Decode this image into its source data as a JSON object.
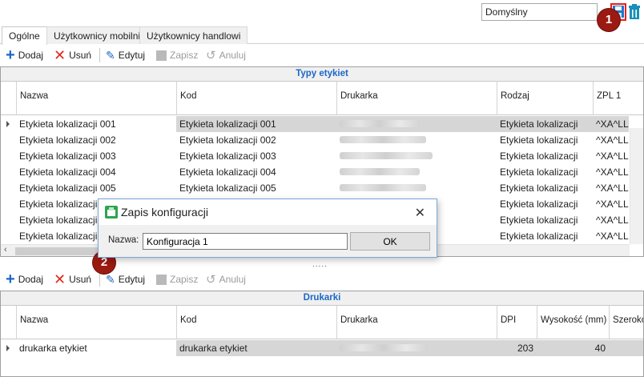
{
  "topbar": {
    "config_value": "Domyślny"
  },
  "badges": {
    "one": "1",
    "two": "2"
  },
  "tabs": [
    "Ogólne",
    "Użytkownicy mobilni",
    "Użytkownicy handlowi"
  ],
  "toolbar": {
    "add": "Dodaj",
    "remove": "Usuń",
    "edit": "Edytuj",
    "save": "Zapisz",
    "cancel": "Anuluj"
  },
  "label_types": {
    "title": "Typy etykiet",
    "columns": [
      "Nazwa",
      "Kod",
      "Drukarka",
      "Rodzaj",
      "ZPL 1"
    ],
    "rows": [
      {
        "name": "Etykieta lokalizacji 001",
        "code": "Etykieta lokalizacji 001",
        "type": "Etykieta lokalizacji",
        "zpl": "^XA^LL"
      },
      {
        "name": "Etykieta lokalizacji 002",
        "code": "Etykieta lokalizacji 002",
        "type": "Etykieta lokalizacji",
        "zpl": "^XA^LL"
      },
      {
        "name": "Etykieta lokalizacji 003",
        "code": "Etykieta lokalizacji 003",
        "type": "Etykieta lokalizacji",
        "zpl": "^XA^LL"
      },
      {
        "name": "Etykieta lokalizacji 004",
        "code": "Etykieta lokalizacji 004",
        "type": "Etykieta lokalizacji",
        "zpl": "^XA^LL"
      },
      {
        "name": "Etykieta lokalizacji 005",
        "code": "Etykieta lokalizacji 005",
        "type": "Etykieta lokalizacji",
        "zpl": "^XA^LL"
      },
      {
        "name": "Etykieta lokalizacji 00",
        "code": "",
        "type": "Etykieta lokalizacji",
        "zpl": "^XA^LL"
      },
      {
        "name": "Etykieta lokalizacji 00",
        "code": "",
        "type": "Etykieta lokalizacji",
        "zpl": "^XA^LL"
      },
      {
        "name": "Etykieta lokalizacji 00",
        "code": "",
        "type": "Etykieta lokalizacji",
        "zpl": "^XA^LL"
      }
    ]
  },
  "printers": {
    "title": "Drukarki",
    "columns": [
      "Nazwa",
      "Kod",
      "Drukarka",
      "DPI",
      "Wysokość (mm)",
      "Szerokość"
    ],
    "rows": [
      {
        "name": "drukarka etykiet",
        "code": "drukarka etykiet",
        "dpi": "203",
        "height": "40"
      }
    ]
  },
  "dialog": {
    "title": "Zapis konfiguracji",
    "label": "Nazwa:",
    "input_value": "Konfiguracja 1",
    "ok": "OK",
    "close": "✕"
  },
  "splitter": "....."
}
